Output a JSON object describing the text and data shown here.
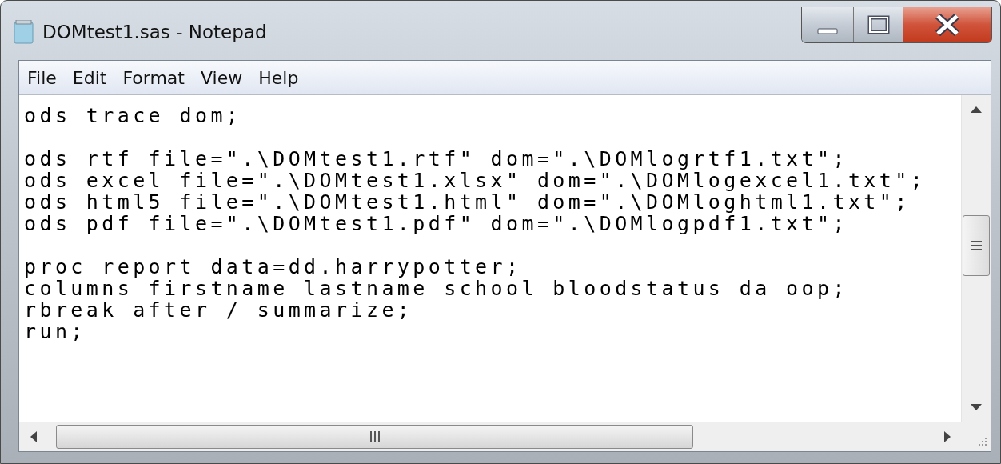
{
  "window": {
    "title": "DOMtest1.sas - Notepad"
  },
  "menu": [
    {
      "label": "File"
    },
    {
      "label": "Edit"
    },
    {
      "label": "Format"
    },
    {
      "label": "View"
    },
    {
      "label": "Help"
    }
  ],
  "editor": {
    "blocks": [
      [
        "ods trace dom;"
      ],
      [
        "ods rtf file=\".\\DOMtest1.rtf\" dom=\".\\DOMlogrtf1.txt\";",
        "ods excel file=\".\\DOMtest1.xlsx\" dom=\".\\DOMlogexcel1.txt\";",
        "ods html5 file=\".\\DOMtest1.html\" dom=\".\\DOMloghtml1.txt\";",
        "ods pdf file=\".\\DOMtest1.pdf\" dom=\".\\DOMlogpdf1.txt\";"
      ],
      [
        "proc report data=dd.harrypotter;",
        "columns firstname lastname school bloodstatus da oop;",
        "rbreak after / summarize;",
        "run;"
      ]
    ]
  }
}
